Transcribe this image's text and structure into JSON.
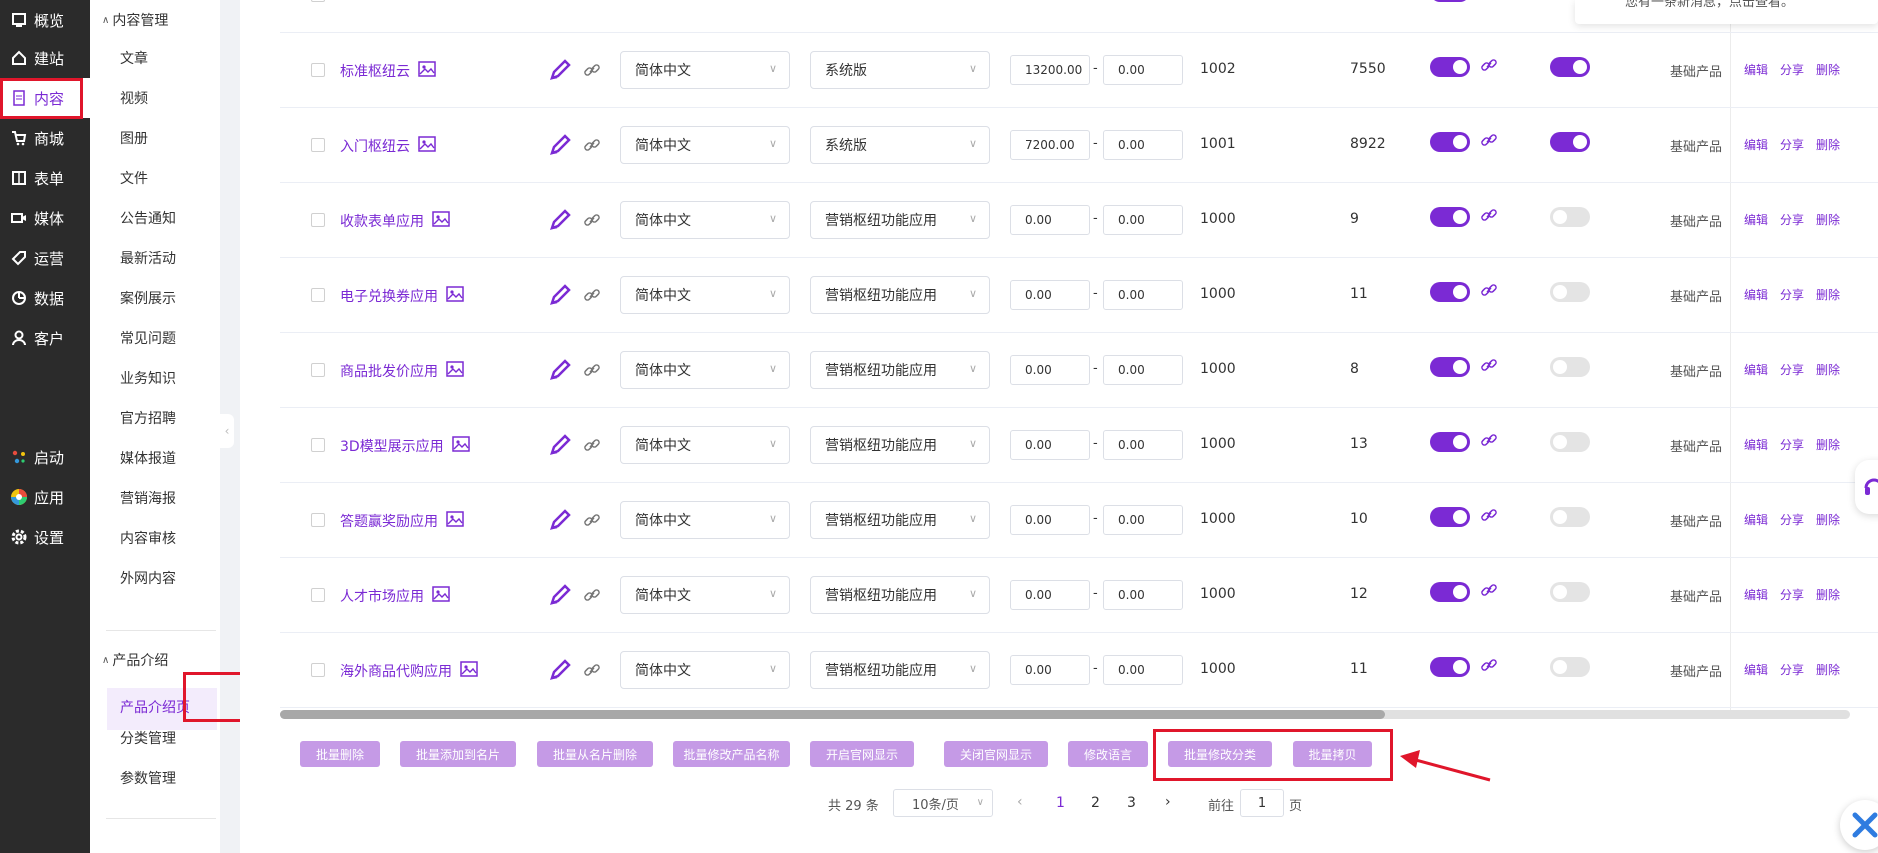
{
  "nav": {
    "items": [
      {
        "label": "概览",
        "icon": "dashboard-icon"
      },
      {
        "label": "建站",
        "icon": "home-icon"
      },
      {
        "label": "内容",
        "icon": "document-icon"
      },
      {
        "label": "商城",
        "icon": "cart-icon"
      },
      {
        "label": "表单",
        "icon": "form-icon"
      },
      {
        "label": "媒体",
        "icon": "video-icon"
      },
      {
        "label": "运营",
        "icon": "tag-icon"
      },
      {
        "label": "数据",
        "icon": "chart-icon"
      },
      {
        "label": "客户",
        "icon": "user-icon"
      },
      {
        "label": "启动",
        "icon": "launch-icon"
      },
      {
        "label": "应用",
        "icon": "apps-icon"
      },
      {
        "label": "设置",
        "icon": "gear-icon"
      }
    ]
  },
  "subnav": {
    "group1": "内容管理",
    "group1_items": [
      "文章",
      "视频",
      "图册",
      "文件",
      "公告通知",
      "最新活动",
      "案例展示",
      "常见问题",
      "业务知识",
      "官方招聘",
      "媒体报道",
      "营销海报",
      "内容审核",
      "外网内容"
    ],
    "group2": "产品介绍",
    "group2_items": [
      "产品介绍页",
      "分类管理",
      "参数管理"
    ]
  },
  "notice_text": "您有一条新消息，点击查看。",
  "rows": [
    {
      "name": "标准枢纽云",
      "lang": "简体中文",
      "version": "系统版",
      "price_a": "13200.00",
      "price_b": "0.00",
      "id": "1002",
      "count": "7550",
      "toggle2": true
    },
    {
      "name": "入门枢纽云",
      "lang": "简体中文",
      "version": "系统版",
      "price_a": "7200.00",
      "price_b": "0.00",
      "id": "1001",
      "count": "8922",
      "toggle2": true
    },
    {
      "name": "收款表单应用",
      "lang": "简体中文",
      "version": "营销枢纽功能应用",
      "price_a": "0.00",
      "price_b": "0.00",
      "id": "1000",
      "count": "9",
      "toggle2": false
    },
    {
      "name": "电子兑换券应用",
      "lang": "简体中文",
      "version": "营销枢纽功能应用",
      "price_a": "0.00",
      "price_b": "0.00",
      "id": "1000",
      "count": "11",
      "toggle2": false
    },
    {
      "name": "商品批发价应用",
      "lang": "简体中文",
      "version": "营销枢纽功能应用",
      "price_a": "0.00",
      "price_b": "0.00",
      "id": "1000",
      "count": "8",
      "toggle2": false
    },
    {
      "name": "3D模型展示应用",
      "lang": "简体中文",
      "version": "营销枢纽功能应用",
      "price_a": "0.00",
      "price_b": "0.00",
      "id": "1000",
      "count": "13",
      "toggle2": false
    },
    {
      "name": "答题赢奖励应用",
      "lang": "简体中文",
      "version": "营销枢纽功能应用",
      "price_a": "0.00",
      "price_b": "0.00",
      "id": "1000",
      "count": "10",
      "toggle2": false
    },
    {
      "name": "人才市场应用",
      "lang": "简体中文",
      "version": "营销枢纽功能应用",
      "price_a": "0.00",
      "price_b": "0.00",
      "id": "1000",
      "count": "12",
      "toggle2": false
    },
    {
      "name": "海外商品代购应用",
      "lang": "简体中文",
      "version": "营销枢纽功能应用",
      "price_a": "0.00",
      "price_b": "0.00",
      "id": "1000",
      "count": "11",
      "toggle2": false
    }
  ],
  "row_common": {
    "category": "基础产品",
    "edit": "编辑",
    "share": "分享",
    "delete": "删除",
    "dash": "-"
  },
  "batch": {
    "delete": "批量删除",
    "add_card": "批量添加到名片",
    "remove_card": "批量从名片删除",
    "rename": "批量修改产品名称",
    "show_site": "开启官网显示",
    "hide_site": "关闭官网显示",
    "change_lang": "修改语言",
    "change_cat": "批量修改分类",
    "copy": "批量拷贝"
  },
  "pagination": {
    "total": "共 29 条",
    "page_size": "10条/页",
    "pages": [
      "1",
      "2",
      "3"
    ],
    "current": "1",
    "goto_label": "前往",
    "goto_value": "1",
    "page_suffix": "页"
  },
  "colors": {
    "accent": "#7b2ad4",
    "annotation": "#e0162b"
  }
}
